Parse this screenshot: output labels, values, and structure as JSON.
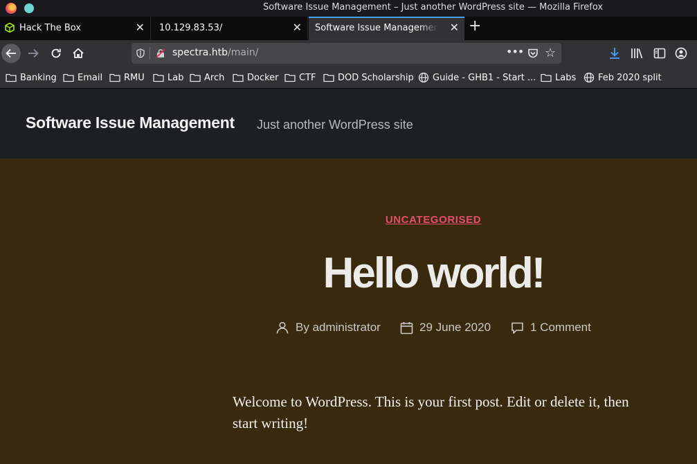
{
  "window": {
    "title": "Software Issue Management – Just another WordPress site — Mozilla Firefox"
  },
  "tabs": [
    {
      "label": "Hack The Box"
    },
    {
      "label": "10.129.83.53/"
    },
    {
      "label": "Software Issue Management – Just another WordPress site"
    }
  ],
  "urlbar": {
    "host": "spectra.htb",
    "path": "/main/"
  },
  "bookmarks": [
    {
      "label": "Banking",
      "icon": "folder-icon"
    },
    {
      "label": "Email",
      "icon": "folder-icon"
    },
    {
      "label": "RMU",
      "icon": "folder-icon"
    },
    {
      "label": "Lab",
      "icon": "folder-icon"
    },
    {
      "label": "Arch",
      "icon": "folder-icon"
    },
    {
      "label": "Docker",
      "icon": "folder-icon"
    },
    {
      "label": "CTF",
      "icon": "folder-icon"
    },
    {
      "label": "DOD Scholarship",
      "icon": "folder-icon"
    },
    {
      "label": "Guide - GHB1 - Start ...",
      "icon": "globe-icon"
    },
    {
      "label": "Labs",
      "icon": "folder-icon"
    },
    {
      "label": "Feb 2020 split",
      "icon": "globe-icon"
    }
  ],
  "site": {
    "title": "Software Issue Management",
    "description": "Just another WordPress site"
  },
  "post": {
    "category": "UNCATEGORISED",
    "title": "Hello world!",
    "author": "By administrator",
    "date": "29 June 2020",
    "comments": "1 Comment",
    "body": "Welcome to WordPress. This is your first post. Edit or delete it, then start writing!"
  },
  "colors": {
    "accent": "#e54f6c",
    "content_bg": "#38290f",
    "header_bg": "#1e1f22",
    "tab_highlight": "#45a1ff"
  }
}
